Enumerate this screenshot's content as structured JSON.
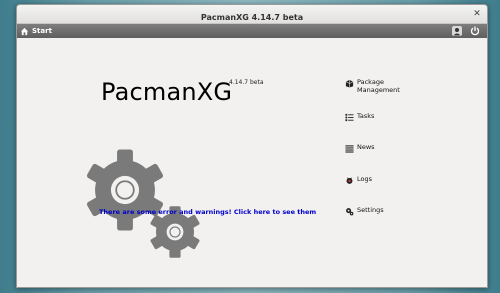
{
  "window": {
    "title": "PacmanXG 4.14.7 beta"
  },
  "toolbar": {
    "start_label": "Start",
    "icons": [
      "home-icon",
      "user-icon",
      "power-icon"
    ]
  },
  "main": {
    "app_name": "PacmanXG",
    "version": "4.14.7 beta",
    "error_link": "There are some error and warnings! Click here to see them"
  },
  "menu": {
    "items": [
      {
        "label_line1": "Package",
        "label_line2": "Management",
        "icon": "package-icon"
      },
      {
        "label": "Tasks",
        "icon": "tasks-icon"
      },
      {
        "label": "News",
        "icon": "news-icon"
      },
      {
        "label": "Logs",
        "icon": "logs-icon"
      },
      {
        "label": "Settings",
        "icon": "settings-icon"
      }
    ]
  },
  "colors": {
    "toolbar": "#6e6e6e",
    "link": "#0000cc",
    "gear": "#7a7a7a",
    "window_bg": "#f2f1f0"
  }
}
